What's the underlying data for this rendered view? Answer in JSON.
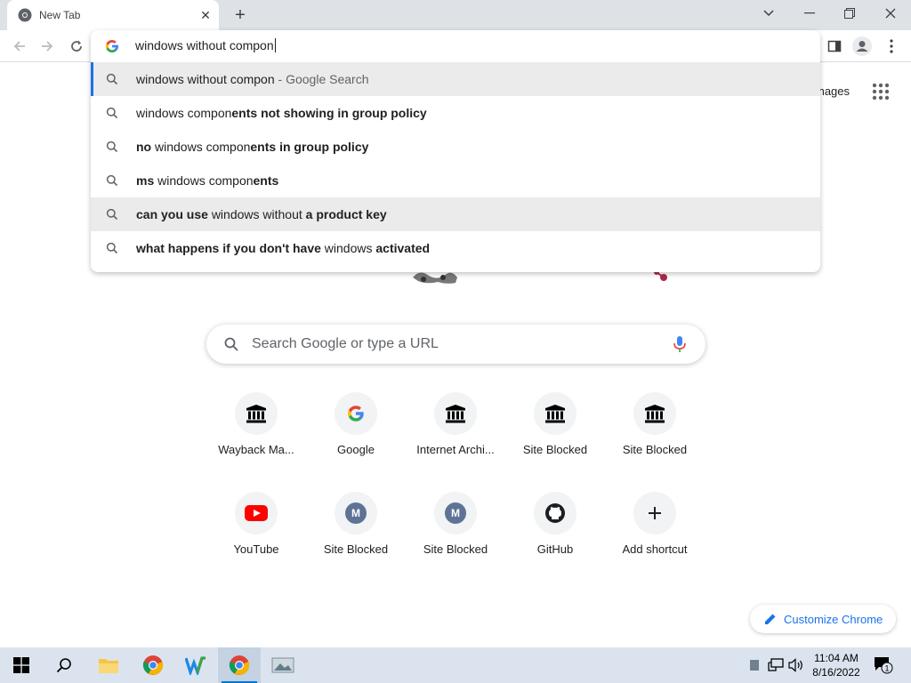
{
  "browser": {
    "tab": {
      "title": "New Tab"
    },
    "omnibox": {
      "value": "windows without compon",
      "suggestions": [
        {
          "parts": [
            [
              "n",
              "windows without compon"
            ]
          ],
          "desc": " - Google Search"
        },
        {
          "parts": [
            [
              "n",
              "windows compon"
            ],
            [
              "b",
              "ents not showing in group policy"
            ]
          ]
        },
        {
          "parts": [
            [
              "b",
              "no "
            ],
            [
              "n",
              "windows compon"
            ],
            [
              "b",
              "ents in group policy"
            ]
          ]
        },
        {
          "parts": [
            [
              "b",
              "ms "
            ],
            [
              "n",
              "windows compon"
            ],
            [
              "b",
              "ents"
            ]
          ]
        },
        {
          "parts": [
            [
              "b",
              "can you use "
            ],
            [
              "n",
              "windows without "
            ],
            [
              "b",
              "a product key"
            ]
          ]
        },
        {
          "parts": [
            [
              "b",
              "what happens if you don't have "
            ],
            [
              "n",
              "windows "
            ],
            [
              "b",
              "activated"
            ]
          ]
        }
      ]
    }
  },
  "page": {
    "gbar": {
      "images_label": "mages"
    },
    "search": {
      "placeholder": "Search Google or type a URL"
    },
    "shortcuts": [
      {
        "label": "Wayback Ma...",
        "icon": "archive-icon"
      },
      {
        "label": "Google",
        "icon": "google-icon"
      },
      {
        "label": "Internet Archi...",
        "icon": "archive-icon"
      },
      {
        "label": "Site Blocked",
        "icon": "archive-icon"
      },
      {
        "label": "Site Blocked",
        "icon": "archive-icon"
      },
      {
        "label": "YouTube",
        "icon": "youtube-icon"
      },
      {
        "label": "Site Blocked",
        "icon": "m-letter-icon",
        "letter": "M"
      },
      {
        "label": "Site Blocked",
        "icon": "m-letter-icon",
        "letter": "M"
      },
      {
        "label": "GitHub",
        "icon": "github-icon"
      },
      {
        "label": "Add shortcut",
        "icon": "plus-icon"
      }
    ],
    "customize_label": "Customize Chrome"
  },
  "taskbar": {
    "time": "11:04 AM",
    "date": "8/16/2022",
    "notification_count": "1"
  },
  "colors": {
    "accent": "#1a73e8",
    "tabstrip": "#dee1e6",
    "taskbar": "#dbe4ee"
  }
}
